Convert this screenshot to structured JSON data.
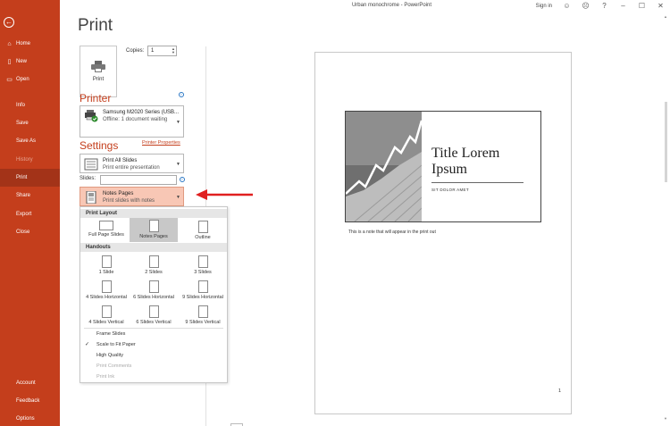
{
  "window": {
    "title": "Urban monochrome - PowerPoint",
    "sign_in": "Sign in",
    "help": "?",
    "minimize": "–",
    "maximize": "☐",
    "close": "✕"
  },
  "sidebar": {
    "back": "←",
    "items": [
      {
        "label": "Home",
        "icon": "home-icon",
        "glyph": "⌂",
        "state": "normal"
      },
      {
        "label": "New",
        "icon": "new-doc-icon",
        "glyph": "▯",
        "state": "normal"
      },
      {
        "label": "Open",
        "icon": "open-folder-icon",
        "glyph": "▭",
        "state": "normal"
      },
      {
        "label": "Info",
        "state": "normal"
      },
      {
        "label": "Save",
        "state": "normal"
      },
      {
        "label": "Save As",
        "state": "normal"
      },
      {
        "label": "History",
        "state": "disabled"
      },
      {
        "label": "Print",
        "state": "active"
      },
      {
        "label": "Share",
        "state": "normal"
      },
      {
        "label": "Export",
        "state": "normal"
      },
      {
        "label": "Close",
        "state": "normal"
      }
    ],
    "bottom": [
      {
        "label": "Account"
      },
      {
        "label": "Feedback"
      },
      {
        "label": "Options"
      }
    ]
  },
  "print_panel": {
    "title": "Print",
    "print_button": "Print",
    "copies_label": "Copies:",
    "copies_value": "1",
    "printer_header": "Printer",
    "printer_name": "Samsung M2020 Series (USB...",
    "printer_status": "Offline: 1 document waiting",
    "printer_properties": "Printer Properties",
    "settings_header": "Settings",
    "range_title": "Print All Slides",
    "range_desc": "Print entire presentation",
    "slides_label": "Slides:",
    "slides_value": "",
    "layout_title": "Notes Pages",
    "layout_desc": "Print slides with notes"
  },
  "layout_menu": {
    "print_layout_header": "Print Layout",
    "print_layout": [
      {
        "label": "Full Page Slides",
        "selected": false
      },
      {
        "label": "Notes Pages",
        "selected": true
      },
      {
        "label": "Outline",
        "selected": false
      }
    ],
    "handouts_header": "Handouts",
    "handouts": [
      {
        "label": "1 Slide"
      },
      {
        "label": "2 Slides"
      },
      {
        "label": "3 Slides"
      },
      {
        "label": "4 Slides Horizontal"
      },
      {
        "label": "6 Slides Horizontal"
      },
      {
        "label": "9 Slides Horizontal"
      },
      {
        "label": "4 Slides Vertical"
      },
      {
        "label": "6 Slides Vertical"
      },
      {
        "label": "9 Slides Vertical"
      }
    ],
    "options": [
      {
        "label": "Frame Slides",
        "checked": false,
        "disabled": false
      },
      {
        "label": "Scale to Fit Paper",
        "checked": true,
        "disabled": false
      },
      {
        "label": "High Quality",
        "checked": false,
        "disabled": false
      },
      {
        "label": "Print Comments",
        "checked": false,
        "disabled": true
      },
      {
        "label": "Print Ink",
        "checked": false,
        "disabled": true
      }
    ]
  },
  "preview": {
    "slide_title": "Title Lorem Ipsum",
    "slide_subtitle": "SIT DOLOR AMET",
    "note_text": "This is a note that will appear in the print out",
    "page_number": "1"
  },
  "colors": {
    "accent": "#c43e1c",
    "active_item": "#a33318",
    "highlight": "#f8c7b5",
    "arrow": "#e02020"
  }
}
